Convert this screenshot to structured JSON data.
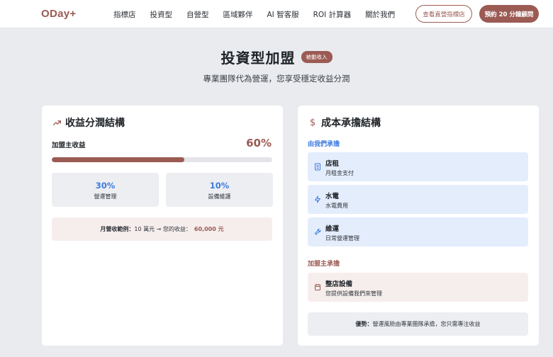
{
  "nav": {
    "logo": "ODay+",
    "links": [
      "指標店",
      "投資型",
      "自營型",
      "區域夥伴",
      "AI 智客服",
      "ROI 計算器",
      "關於我們"
    ],
    "view_store_label": "查看直營指標店",
    "book_label": "預約 20 分鐘顧問"
  },
  "hero": {
    "title": "投資型加盟",
    "badge": "被動收入",
    "subtitle": "專業團隊代為營運，您享受穩定收益分潤"
  },
  "revenue": {
    "title": "收益分潤結構",
    "owner_label": "加盟主收益",
    "owner_pct": "60%",
    "owner_share": 0.6,
    "ops_pct": "30%",
    "ops_label": "營運管理",
    "maint_pct": "10%",
    "maint_label": "設備維護",
    "example_prefix": "月營收範例：",
    "example_text": "10 萬元 → 您的收益：",
    "example_amount": "60,000 元"
  },
  "cost": {
    "title": "成本承擔結構",
    "we_label": "由我們承擔",
    "we_items": [
      {
        "title": "店租",
        "desc": "月租金支付",
        "icon": "building-icon"
      },
      {
        "title": "水電",
        "desc": "水電費用",
        "icon": "zap-icon"
      },
      {
        "title": "維運",
        "desc": "日常營運管理",
        "icon": "wrench-icon"
      }
    ],
    "owner_label": "加盟主承擔",
    "owner_items": [
      {
        "title": "整店設備",
        "desc": "您提供設備我們來管理",
        "icon": "calendar-icon"
      }
    ],
    "advantage_prefix": "優勢：",
    "advantage_text": "營運風險由專業團隊承擔，您只需專注收益"
  },
  "colors": {
    "brand": "#9b5b54",
    "accent_blue": "#3d7be0"
  }
}
